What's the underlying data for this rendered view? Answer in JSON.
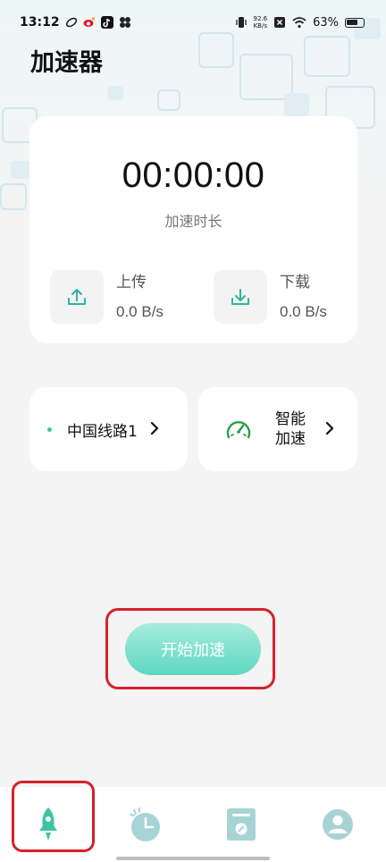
{
  "status_bar": {
    "time": "13:12",
    "net_speed_value": "92.6",
    "net_speed_unit": "KB/s",
    "battery": "63%"
  },
  "page": {
    "title": "加速器"
  },
  "timer": {
    "value": "00:00:00",
    "label": "加速时长"
  },
  "upload": {
    "title": "上传",
    "value": "0.0 B/s"
  },
  "download": {
    "title": "下载",
    "value": "0.0 B/s"
  },
  "route": {
    "label": "中国线路1"
  },
  "mode": {
    "label": "智能加速"
  },
  "start_button": {
    "label": "开始加速"
  },
  "colors": {
    "accent": "#3cc3a7",
    "nav_inactive": "#a8d3d6",
    "highlight": "#d8202c"
  },
  "nav": {
    "items": [
      "rocket-icon",
      "clock-icon",
      "log-icon",
      "user-icon"
    ]
  }
}
